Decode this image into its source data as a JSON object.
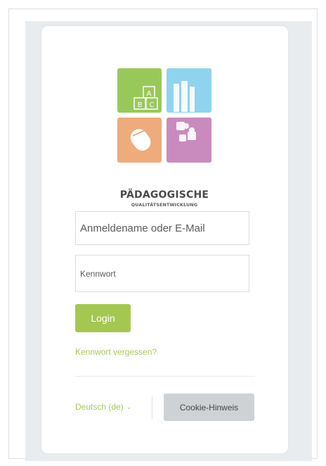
{
  "logo": {
    "title": "PÄDAGOGISCHE",
    "subtitle": "QUALITÄTSENTWICKLUNG",
    "block_letters": [
      "A",
      "B",
      "C"
    ],
    "colors": {
      "green": "#99c85a",
      "blue": "#8fd3ee",
      "orange": "#eeab7c",
      "purple": "#c98bbd"
    }
  },
  "form": {
    "username_placeholder": "Anmeldename oder E-Mail",
    "password_placeholder": "Kennwort",
    "login_label": "Login",
    "forgot_label": "Kennwort vergessen?"
  },
  "footer": {
    "language_label": "Deutsch (de)",
    "cookie_label": "Cookie-Hinweis"
  },
  "colors": {
    "accent": "#a4c752",
    "link": "#a6c759",
    "button_gray": "#cfd2d5"
  }
}
